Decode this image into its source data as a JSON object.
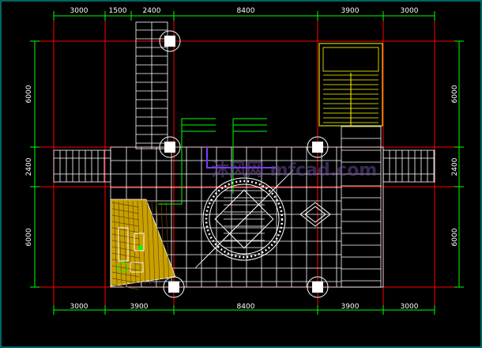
{
  "plan": {
    "top_dims": [
      "3000",
      "1500",
      "2400",
      "8400",
      "3900",
      "3000"
    ],
    "bottom_dims": [
      "3000",
      "3900",
      "8400",
      "3900",
      "3000"
    ],
    "left_dims": [
      "6000",
      "2400",
      "6000"
    ],
    "right_dims": [
      "6000",
      "2400",
      "6000"
    ],
    "watermark": "沐风网 mfcad.com"
  },
  "colors": {
    "background": "#000000",
    "grid_axis": "#ff0000",
    "dimension": "#00ff00",
    "paving": "#ffffff",
    "stair": "#ffff00",
    "deck": "#c8a000",
    "accent": "#7a3cff"
  }
}
